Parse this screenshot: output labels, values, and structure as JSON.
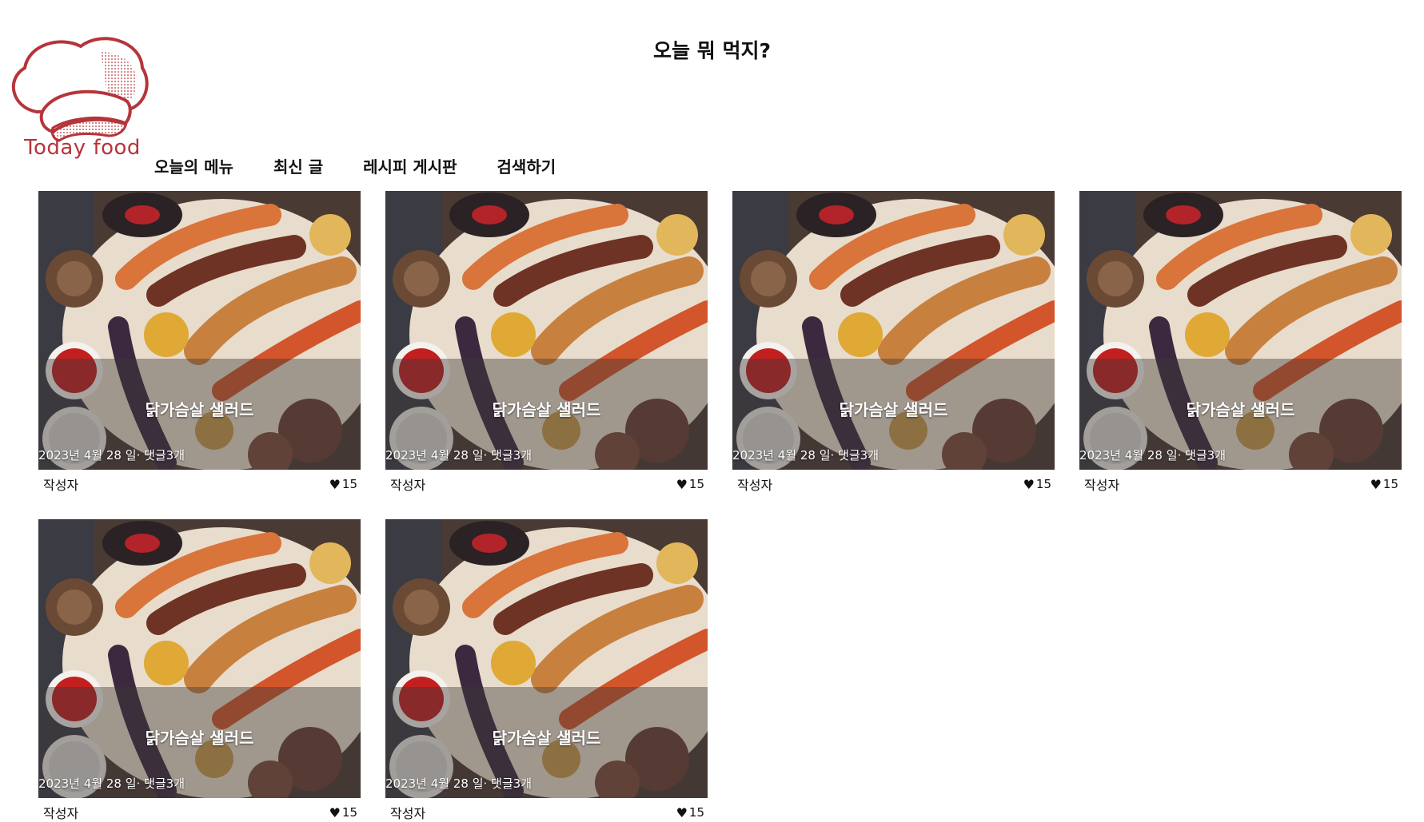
{
  "header": {
    "title": "오늘 뭐 먹지?",
    "logo_text": "Today food"
  },
  "nav": {
    "items": [
      {
        "label": "오늘의 메뉴"
      },
      {
        "label": "최신 글"
      },
      {
        "label": "레시피 게시판"
      },
      {
        "label": "검색하기"
      }
    ]
  },
  "cards": [
    {
      "title": "닭가슴살 샐러드",
      "meta": "2023년 4월 28 일· 댓글3개",
      "author": "작성자",
      "likes": "15"
    },
    {
      "title": "닭가슴살 샐러드",
      "meta": "2023년 4월 28 일· 댓글3개",
      "author": "작성자",
      "likes": "15"
    },
    {
      "title": "닭가슴살 샐러드",
      "meta": "2023년 4월 28 일· 댓글3개",
      "author": "작성자",
      "likes": "15"
    },
    {
      "title": "닭가슴살 샐러드",
      "meta": "2023년 4월 28 일· 댓글3개",
      "author": "작성자",
      "likes": "15"
    },
    {
      "title": "닭가슴살 샐러드",
      "meta": "2023년 4월 28 일· 댓글3개",
      "author": "작성자",
      "likes": "15"
    },
    {
      "title": "닭가슴살 샐러드",
      "meta": "2023년 4월 28 일· 댓글3개",
      "author": "작성자",
      "likes": "15"
    }
  ],
  "icons": {
    "like": "heart-icon",
    "logo": "chef-hat-icon"
  },
  "colors": {
    "brand": "#b5353a",
    "text": "#111111",
    "overlay": "#3c3737"
  }
}
